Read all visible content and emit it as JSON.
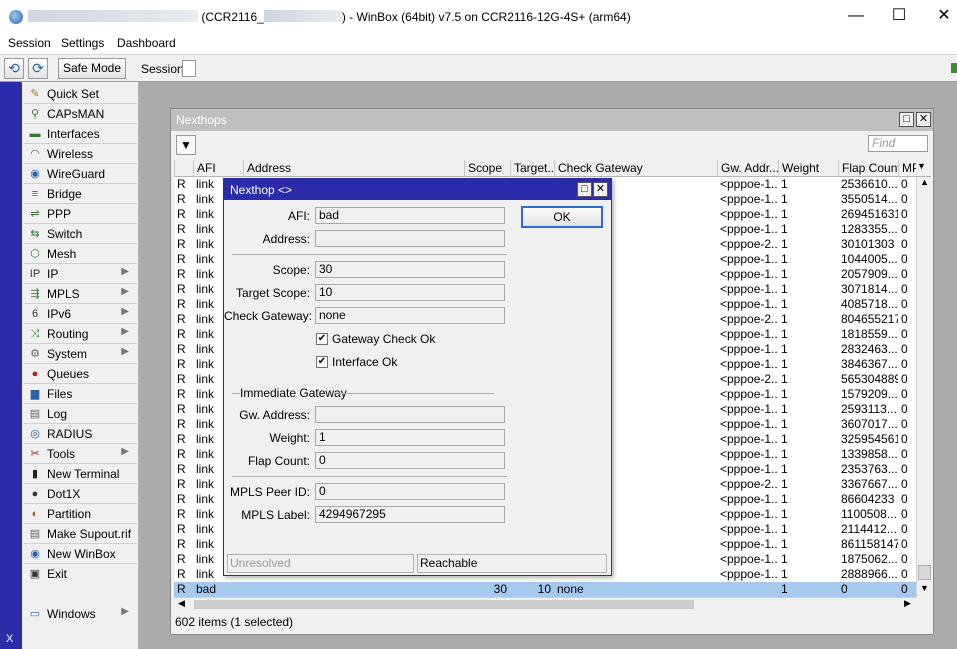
{
  "window": {
    "title_prefix": "",
    "title_middle": "(CCR2116_",
    "title_suffix": ") - WinBox (64bit) v7.5 on CCR2116-12G-4S+ (arm64)",
    "minimize": "—",
    "maximize": "☐",
    "close": "✕"
  },
  "menu": {
    "session": "Session",
    "settings": "Settings",
    "dashboard": "Dashboard"
  },
  "toolbar": {
    "undo": "⟲",
    "redo": "⟳",
    "safe_mode": "Safe Mode",
    "session_label": "Session:"
  },
  "side_strip": "X",
  "sidebar": {
    "items": [
      {
        "label": "Quick Set",
        "icon": "quick-set-icon",
        "glyph": "✎",
        "color": "#b0730e",
        "arrow": false
      },
      {
        "label": "CAPsMAN",
        "icon": "capsman-icon",
        "glyph": "⚲",
        "color": "#3a7a3a",
        "arrow": false
      },
      {
        "label": "Interfaces",
        "icon": "interfaces-icon",
        "glyph": "▬",
        "color": "#2f7a2f",
        "arrow": false
      },
      {
        "label": "Wireless",
        "icon": "wireless-icon",
        "glyph": "◠",
        "color": "#3a7a3a",
        "arrow": false
      },
      {
        "label": "WireGuard",
        "icon": "wireguard-icon",
        "glyph": "◉",
        "color": "#2d62a8",
        "arrow": false
      },
      {
        "label": "Bridge",
        "icon": "bridge-icon",
        "glyph": "≡",
        "color": "#3a7a3a",
        "arrow": false
      },
      {
        "label": "PPP",
        "icon": "ppp-icon",
        "glyph": "⇌",
        "color": "#3a7a3a",
        "arrow": false
      },
      {
        "label": "Switch",
        "icon": "switch-icon",
        "glyph": "⇆",
        "color": "#3a7a3a",
        "arrow": false
      },
      {
        "label": "Mesh",
        "icon": "mesh-icon",
        "glyph": "⬡",
        "color": "#3a7a3a",
        "arrow": false
      },
      {
        "label": "IP",
        "icon": "ip-icon",
        "glyph": "IP",
        "color": "#333333",
        "arrow": true
      },
      {
        "label": "MPLS",
        "icon": "mpls-icon",
        "glyph": "⇶",
        "color": "#3a7a3a",
        "arrow": true
      },
      {
        "label": "IPv6",
        "icon": "ipv6-icon",
        "glyph": "6",
        "color": "#333333",
        "arrow": true
      },
      {
        "label": "Routing",
        "icon": "routing-icon",
        "glyph": "⤨",
        "color": "#3a7a3a",
        "arrow": true
      },
      {
        "label": "System",
        "icon": "system-icon",
        "glyph": "⚙",
        "color": "#666666",
        "arrow": true
      },
      {
        "label": "Queues",
        "icon": "queues-icon",
        "glyph": "●",
        "color": "#b02020",
        "arrow": false
      },
      {
        "label": "Files",
        "icon": "files-icon",
        "glyph": "▆",
        "color": "#2d62a8",
        "arrow": false
      },
      {
        "label": "Log",
        "icon": "log-icon",
        "glyph": "▤",
        "color": "#666666",
        "arrow": false
      },
      {
        "label": "RADIUS",
        "icon": "radius-icon",
        "glyph": "◎",
        "color": "#2a5a8a",
        "arrow": false
      },
      {
        "label": "Tools",
        "icon": "tools-icon",
        "glyph": "✂",
        "color": "#b02020",
        "arrow": true
      },
      {
        "label": "New Terminal",
        "icon": "terminal-icon",
        "glyph": "▮",
        "color": "#222222",
        "arrow": false
      },
      {
        "label": "Dot1X",
        "icon": "dot1x-icon",
        "glyph": "●",
        "color": "#333333",
        "arrow": false
      },
      {
        "label": "Partition",
        "icon": "partition-icon",
        "glyph": "◐",
        "color": "#b05020",
        "arrow": false
      },
      {
        "label": "Make Supout.rif",
        "icon": "supout-icon",
        "glyph": "▤",
        "color": "#666666",
        "arrow": false
      },
      {
        "label": "New WinBox",
        "icon": "winbox-icon",
        "glyph": "◉",
        "color": "#2d62a8",
        "arrow": false
      },
      {
        "label": "Exit",
        "icon": "exit-icon",
        "glyph": "▣",
        "color": "#333333",
        "arrow": false
      }
    ],
    "windows": {
      "label": "Windows",
      "icon": "windows-icon",
      "glyph": "▭",
      "color": "#2d62a8",
      "arrow": true
    }
  },
  "nexthops": {
    "title": "Nexthops",
    "find_placeholder": "Find",
    "columns": [
      "AFI",
      "Address",
      "Scope",
      "Target...",
      "Check Gateway",
      "Gw. Addr...",
      "Weight",
      "Flap Count",
      "MP"
    ],
    "rows": [
      {
        "f": "R",
        "afi": "link",
        "gw": "<pppoe-1...",
        "w": "1",
        "flap": "2536610...",
        "mp": "0"
      },
      {
        "f": "R",
        "afi": "link",
        "gw": "<pppoe-1...",
        "w": "1",
        "flap": "3550514...",
        "mp": "0"
      },
      {
        "f": "R",
        "afi": "link",
        "gw": "<pppoe-1...",
        "w": "1",
        "flap": "269451631",
        "mp": "0"
      },
      {
        "f": "R",
        "afi": "link",
        "gw": "<pppoe-1...",
        "w": "1",
        "flap": "1283355...",
        "mp": "0"
      },
      {
        "f": "R",
        "afi": "link",
        "gw": "<pppoe-2...",
        "w": "1",
        "flap": "30101303",
        "mp": "0"
      },
      {
        "f": "R",
        "afi": "link",
        "gw": "<pppoe-1...",
        "w": "1",
        "flap": "1044005...",
        "mp": "0"
      },
      {
        "f": "R",
        "afi": "link",
        "gw": "<pppoe-1...",
        "w": "1",
        "flap": "2057909...",
        "mp": "0"
      },
      {
        "f": "R",
        "afi": "link",
        "gw": "<pppoe-1...",
        "w": "1",
        "flap": "3071814...",
        "mp": "0"
      },
      {
        "f": "R",
        "afi": "link",
        "gw": "<pppoe-1...",
        "w": "1",
        "flap": "4085718...",
        "mp": "0"
      },
      {
        "f": "R",
        "afi": "link",
        "gw": "<pppoe-2...",
        "w": "1",
        "flap": "804655217",
        "mp": "0"
      },
      {
        "f": "R",
        "afi": "link",
        "gw": "<pppoe-1...",
        "w": "1",
        "flap": "1818559...",
        "mp": "0"
      },
      {
        "f": "R",
        "afi": "link",
        "gw": "<pppoe-1...",
        "w": "1",
        "flap": "2832463...",
        "mp": "0"
      },
      {
        "f": "R",
        "afi": "link",
        "gw": "<pppoe-1...",
        "w": "1",
        "flap": "3846367...",
        "mp": "0"
      },
      {
        "f": "R",
        "afi": "link",
        "gw": "<pppoe-2...",
        "w": "1",
        "flap": "565304889",
        "mp": "0"
      },
      {
        "f": "R",
        "afi": "link",
        "gw": "<pppoe-1...",
        "w": "1",
        "flap": "1579209...",
        "mp": "0"
      },
      {
        "f": "R",
        "afi": "link",
        "gw": "<pppoe-1...",
        "w": "1",
        "flap": "2593113...",
        "mp": "0"
      },
      {
        "f": "R",
        "afi": "link",
        "gw": "<pppoe-1...",
        "w": "1",
        "flap": "3607017...",
        "mp": "0"
      },
      {
        "f": "R",
        "afi": "link",
        "gw": "<pppoe-1...",
        "w": "1",
        "flap": "325954561",
        "mp": "0"
      },
      {
        "f": "R",
        "afi": "link",
        "gw": "<pppoe-1...",
        "w": "1",
        "flap": "1339858...",
        "mp": "0"
      },
      {
        "f": "R",
        "afi": "link",
        "gw": "<pppoe-1...",
        "w": "1",
        "flap": "2353763...",
        "mp": "0"
      },
      {
        "f": "R",
        "afi": "link",
        "gw": "<pppoe-2...",
        "w": "1",
        "flap": "3367667...",
        "mp": "0"
      },
      {
        "f": "R",
        "afi": "link",
        "gw": "<pppoe-1...",
        "w": "1",
        "flap": "86604233",
        "mp": "0"
      },
      {
        "f": "R",
        "afi": "link",
        "gw": "<pppoe-1...",
        "w": "1",
        "flap": "1100508...",
        "mp": "0"
      },
      {
        "f": "R",
        "afi": "link",
        "gw": "<pppoe-1...",
        "w": "1",
        "flap": "2114412...",
        "mp": "0"
      },
      {
        "f": "R",
        "afi": "link",
        "gw": "<pppoe-1...",
        "w": "1",
        "flap": "861158147",
        "mp": "0"
      },
      {
        "f": "R",
        "afi": "link",
        "gw": "<pppoe-1...",
        "w": "1",
        "flap": "1875062...",
        "mp": "0"
      },
      {
        "f": "R",
        "afi": "link",
        "gw": "<pppoe-1...",
        "w": "1",
        "flap": "2888966...",
        "mp": "0"
      }
    ],
    "selected_row": {
      "f": "R",
      "afi": "bad",
      "scope": "30",
      "target": "10",
      "check": "none",
      "w": "1",
      "flap": "0",
      "mp": "0"
    },
    "status": "602 items (1 selected)"
  },
  "dialog": {
    "title": "Nexthop <>",
    "ok": "OK",
    "afi_label": "AFI:",
    "afi": "bad",
    "address_label": "Address:",
    "address": "",
    "scope_label": "Scope:",
    "scope": "30",
    "target_scope_label": "Target Scope:",
    "target_scope": "10",
    "check_gateway_label": "Check Gateway:",
    "check_gateway": "none",
    "gateway_check_ok": "Gateway Check Ok",
    "interface_ok": "Interface Ok",
    "immediate_gateway": "Immediate Gateway",
    "gw_address_label": "Gw. Address:",
    "gw_address": "",
    "weight_label": "Weight:",
    "weight": "1",
    "flap_count_label": "Flap Count:",
    "flap_count": "0",
    "mpls_peer_id_label": "MPLS Peer ID:",
    "mpls_peer_id": "0",
    "mpls_label_label": "MPLS Label:",
    "mpls_label": "4294967295",
    "status_left": "Unresolved",
    "status_right": "Reachable"
  },
  "colors": {
    "accent": "#2c2caa",
    "selected_row": "#a6c9ee",
    "inactive_title": "#bfbfbf"
  }
}
